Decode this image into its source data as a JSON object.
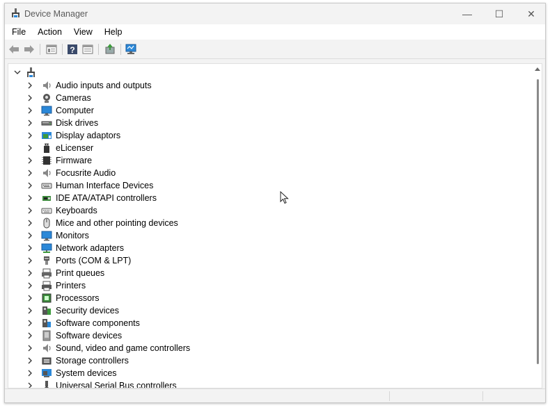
{
  "window": {
    "title": "Device Manager",
    "minimize_glyph": "—",
    "maximize_glyph": "☐",
    "close_glyph": "✕"
  },
  "menu": [
    {
      "label": "File"
    },
    {
      "label": "Action"
    },
    {
      "label": "View"
    },
    {
      "label": "Help"
    }
  ],
  "toolbar": {
    "icons": [
      "back-arrow-icon",
      "forward-arrow-icon",
      "properties-icon",
      "help-icon",
      "properties-sheet-icon",
      "update-driver-icon",
      "scan-hardware-icon"
    ]
  },
  "tree": {
    "root_expanded": true,
    "categories": [
      {
        "label": "Audio inputs and outputs",
        "icon": "speaker-icon"
      },
      {
        "label": "Cameras",
        "icon": "camera-icon"
      },
      {
        "label": "Computer",
        "icon": "computer-icon"
      },
      {
        "label": "Disk drives",
        "icon": "disk-drive-icon"
      },
      {
        "label": "Display adaptors",
        "icon": "display-adapter-icon"
      },
      {
        "label": "eLicenser",
        "icon": "usb-key-icon"
      },
      {
        "label": "Firmware",
        "icon": "firmware-chip-icon"
      },
      {
        "label": "Focusrite Audio",
        "icon": "audio-device-icon"
      },
      {
        "label": "Human Interface Devices",
        "icon": "hid-icon"
      },
      {
        "label": "IDE ATA/ATAPI controllers",
        "icon": "ide-controller-icon"
      },
      {
        "label": "Keyboards",
        "icon": "keyboard-icon"
      },
      {
        "label": "Mice and other pointing devices",
        "icon": "mouse-icon"
      },
      {
        "label": "Monitors",
        "icon": "monitor-icon"
      },
      {
        "label": "Network adapters",
        "icon": "network-adapter-icon"
      },
      {
        "label": "Ports (COM & LPT)",
        "icon": "port-icon"
      },
      {
        "label": "Print queues",
        "icon": "print-queue-icon"
      },
      {
        "label": "Printers",
        "icon": "printer-icon"
      },
      {
        "label": "Processors",
        "icon": "processor-icon"
      },
      {
        "label": "Security devices",
        "icon": "security-device-icon"
      },
      {
        "label": "Software components",
        "icon": "software-component-icon"
      },
      {
        "label": "Software devices",
        "icon": "software-device-icon"
      },
      {
        "label": "Sound, video and game controllers",
        "icon": "sound-controller-icon"
      },
      {
        "label": "Storage controllers",
        "icon": "storage-controller-icon"
      },
      {
        "label": "System devices",
        "icon": "system-device-icon"
      },
      {
        "label": "Universal Serial Bus controllers",
        "icon": "usb-controller-icon"
      }
    ]
  },
  "colors": {
    "window_bg": "#f3f3f3",
    "content_bg": "#ffffff",
    "monitor_blue": "#2b88d8",
    "text": "#000000"
  }
}
